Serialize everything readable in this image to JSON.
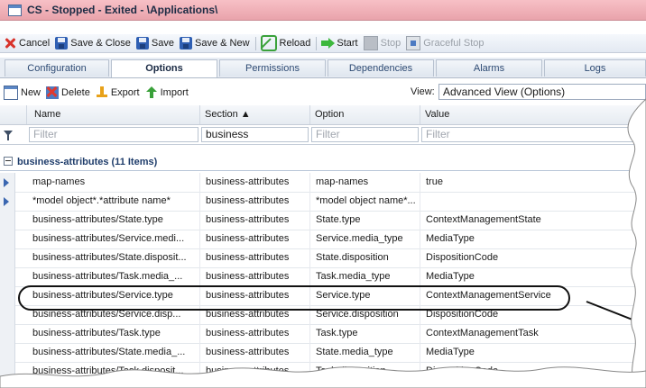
{
  "window": {
    "title": "CS - Stopped - Exited - \\Applications\\"
  },
  "toolbar": {
    "cancel": "Cancel",
    "save_close": "Save & Close",
    "save": "Save",
    "save_new": "Save & New",
    "reload": "Reload",
    "start": "Start",
    "stop": "Stop",
    "graceful_stop": "Graceful Stop"
  },
  "tabs": [
    {
      "label": "Configuration"
    },
    {
      "label": "Options"
    },
    {
      "label": "Permissions"
    },
    {
      "label": "Dependencies"
    },
    {
      "label": "Alarms"
    },
    {
      "label": "Logs"
    }
  ],
  "grid_toolbar": {
    "new": "New",
    "delete": "Delete",
    "export": "Export",
    "import": "Import",
    "view_label": "View:",
    "view_value": "Advanced View (Options)"
  },
  "columns": {
    "name": "Name",
    "section": "Section ▲",
    "option": "Option",
    "value": "Value"
  },
  "filters": {
    "name": "Filter",
    "section": "business",
    "option": "Filter",
    "value": "Filter"
  },
  "group": {
    "label": "business-attributes (11 Items)"
  },
  "rows": [
    {
      "name": "map-names",
      "section": "business-attributes",
      "option": "map-names",
      "value": "true"
    },
    {
      "name": "*model object*.*attribute name*",
      "section": "business-attributes",
      "option": "*model object name*...",
      "value": ""
    },
    {
      "name": "business-attributes/State.type",
      "section": "business-attributes",
      "option": "State.type",
      "value": "ContextManagementState"
    },
    {
      "name": "business-attributes/Service.medi...",
      "section": "business-attributes",
      "option": "Service.media_type",
      "value": "MediaType"
    },
    {
      "name": "business-attributes/State.disposit...",
      "section": "business-attributes",
      "option": "State.disposition",
      "value": "DispositionCode"
    },
    {
      "name": "business-attributes/Task.media_...",
      "section": "business-attributes",
      "option": "Task.media_type",
      "value": "MediaType"
    },
    {
      "name": "business-attributes/Service.type",
      "section": "business-attributes",
      "option": "Service.type",
      "value": "ContextManagementService"
    },
    {
      "name": "business-attributes/Service.disp...",
      "section": "business-attributes",
      "option": "Service.disposition",
      "value": "DispositionCode"
    },
    {
      "name": "business-attributes/Task.type",
      "section": "business-attributes",
      "option": "Task.type",
      "value": "ContextManagementTask"
    },
    {
      "name": "business-attributes/State.media_...",
      "section": "business-attributes",
      "option": "State.media_type",
      "value": "MediaType"
    },
    {
      "name": "business-attributes/Task.disposit...",
      "section": "business-attributes",
      "option": "Task.disposition",
      "value": "DispositionCode"
    }
  ],
  "colors": {
    "titlebar": "#f2b3ba",
    "accent": "#2f5fb3",
    "selected_row_highlight": "#111111"
  }
}
